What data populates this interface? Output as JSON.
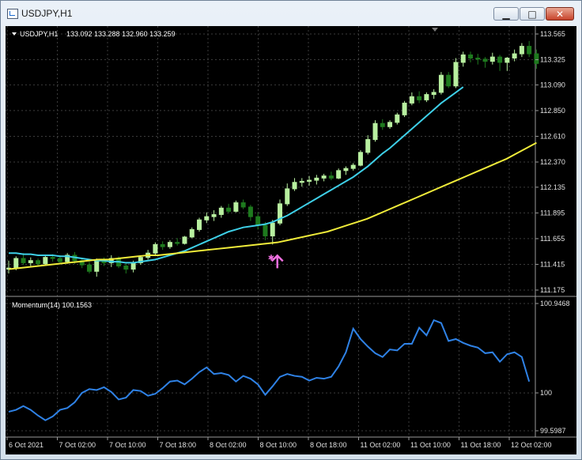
{
  "window": {
    "title": "USDJPY,H1",
    "buttons": {
      "minimize": "▁",
      "maximize": "□",
      "close": "✕"
    }
  },
  "colors": {
    "background": "#000000",
    "grid": "#3c3c3c",
    "axis_text": "#e0e0e0",
    "bull_candle": "#b8f0a0",
    "bear_candle": "#1e7a1e",
    "ma_fast": "#3ed0e8",
    "ma_slow": "#f0ec3a",
    "momentum": "#2f82e6",
    "signal_arrow": "#f070e0"
  },
  "chart_data": [
    {
      "type": "candlestick",
      "symbol_label": "USDJPY,H1",
      "ohlc_label": "133.092 133.288 132.960 133.259",
      "y_ticks": [
        "113.565",
        "113.325",
        "113.090",
        "112.850",
        "112.610",
        "112.370",
        "112.135",
        "111.895",
        "111.655",
        "111.415",
        "111.175"
      ],
      "ylim": [
        111.175,
        113.565
      ],
      "x_ticks": [
        "6 Oct 2021",
        "7 Oct 02:00",
        "7 Oct 10:00",
        "7 Oct 18:00",
        "8 Oct 02:00",
        "8 Oct 10:00",
        "8 Oct 18:00",
        "11 Oct 02:00",
        "11 Oct 10:00",
        "11 Oct 18:00",
        "12 Oct 02:00"
      ],
      "candles": [
        [
          111.37,
          111.45,
          111.33,
          111.38
        ],
        [
          111.38,
          111.49,
          111.36,
          111.47
        ],
        [
          111.47,
          111.52,
          111.41,
          111.43
        ],
        [
          111.43,
          111.48,
          111.4,
          111.45
        ],
        [
          111.45,
          111.47,
          111.4,
          111.42
        ],
        [
          111.42,
          111.5,
          111.41,
          111.48
        ],
        [
          111.48,
          111.51,
          111.44,
          111.47
        ],
        [
          111.47,
          111.5,
          111.43,
          111.44
        ],
        [
          111.44,
          111.52,
          111.42,
          111.5
        ],
        [
          111.5,
          111.53,
          111.42,
          111.45
        ],
        [
          111.45,
          111.47,
          111.38,
          111.41
        ],
        [
          111.41,
          111.44,
          111.33,
          111.35
        ],
        [
          111.35,
          111.47,
          111.3,
          111.45
        ],
        [
          111.45,
          111.48,
          111.4,
          111.43
        ],
        [
          111.43,
          111.5,
          111.39,
          111.47
        ],
        [
          111.47,
          111.49,
          111.38,
          111.4
        ],
        [
          111.4,
          111.43,
          111.33,
          111.37
        ],
        [
          111.37,
          111.45,
          111.34,
          111.43
        ],
        [
          111.43,
          111.5,
          111.41,
          111.48
        ],
        [
          111.48,
          111.55,
          111.46,
          111.52
        ],
        [
          111.52,
          111.62,
          111.5,
          111.6
        ],
        [
          111.6,
          111.63,
          111.55,
          111.58
        ],
        [
          111.58,
          111.64,
          111.56,
          111.62
        ],
        [
          111.62,
          111.66,
          111.59,
          111.61
        ],
        [
          111.61,
          111.68,
          111.6,
          111.67
        ],
        [
          111.67,
          111.76,
          111.66,
          111.74
        ],
        [
          111.74,
          111.85,
          111.72,
          111.83
        ],
        [
          111.83,
          111.9,
          111.8,
          111.86
        ],
        [
          111.86,
          111.92,
          111.82,
          111.88
        ],
        [
          111.88,
          111.96,
          111.85,
          111.94
        ],
        [
          111.94,
          111.98,
          111.89,
          111.91
        ],
        [
          111.91,
          112.01,
          111.9,
          111.99
        ],
        [
          111.99,
          112.02,
          111.93,
          111.95
        ],
        [
          111.95,
          111.97,
          111.82,
          111.86
        ],
        [
          111.86,
          111.9,
          111.74,
          111.78
        ],
        [
          111.78,
          111.81,
          111.64,
          111.68
        ],
        [
          111.68,
          111.83,
          111.6,
          111.8
        ],
        [
          111.8,
          112.02,
          111.78,
          111.98
        ],
        [
          111.98,
          112.17,
          111.96,
          112.12
        ],
        [
          112.12,
          112.22,
          112.1,
          112.18
        ],
        [
          112.18,
          112.22,
          112.14,
          112.19
        ],
        [
          112.19,
          112.24,
          112.15,
          112.2
        ],
        [
          112.2,
          112.25,
          112.16,
          112.22
        ],
        [
          112.22,
          112.26,
          112.19,
          112.24
        ],
        [
          112.24,
          112.28,
          112.2,
          112.22
        ],
        [
          112.22,
          112.31,
          112.21,
          112.29
        ],
        [
          112.29,
          112.33,
          112.25,
          112.31
        ],
        [
          112.31,
          112.36,
          112.29,
          112.34
        ],
        [
          112.34,
          112.48,
          112.33,
          112.46
        ],
        [
          112.46,
          112.62,
          112.44,
          112.58
        ],
        [
          112.58,
          112.76,
          112.56,
          112.73
        ],
        [
          112.73,
          112.77,
          112.67,
          112.7
        ],
        [
          112.7,
          112.76,
          112.68,
          112.74
        ],
        [
          112.74,
          112.83,
          112.72,
          112.81
        ],
        [
          112.81,
          112.94,
          112.79,
          112.92
        ],
        [
          112.92,
          113.02,
          112.9,
          112.98
        ],
        [
          112.98,
          113.03,
          112.92,
          112.95
        ],
        [
          112.95,
          113.02,
          112.93,
          113.0
        ],
        [
          113.0,
          113.05,
          112.96,
          113.02
        ],
        [
          113.02,
          113.21,
          113.0,
          113.18
        ],
        [
          113.18,
          113.21,
          113.06,
          113.08
        ],
        [
          113.08,
          113.34,
          113.06,
          113.3
        ],
        [
          113.3,
          113.4,
          113.26,
          113.37
        ],
        [
          113.37,
          113.4,
          113.3,
          113.34
        ],
        [
          113.34,
          113.38,
          113.28,
          113.33
        ],
        [
          113.33,
          113.35,
          113.25,
          113.31
        ],
        [
          113.31,
          113.39,
          113.28,
          113.35
        ],
        [
          113.35,
          113.37,
          113.22,
          113.3
        ],
        [
          113.3,
          113.35,
          113.22,
          113.34
        ],
        [
          113.34,
          113.42,
          113.31,
          113.38
        ],
        [
          113.38,
          113.48,
          113.35,
          113.45
        ],
        [
          113.45,
          113.5,
          113.35,
          113.38
        ],
        [
          113.38,
          113.42,
          113.24,
          113.29
        ]
      ],
      "ma_fast": [
        111.52,
        111.52,
        111.51,
        111.51,
        111.5,
        111.5,
        111.5,
        111.49,
        111.49,
        111.48,
        111.47,
        111.46,
        111.45,
        111.45,
        111.44,
        111.44,
        111.43,
        111.43,
        111.44,
        111.45,
        111.46,
        111.48,
        111.5,
        111.52,
        111.54,
        111.57,
        111.6,
        111.63,
        111.66,
        111.69,
        111.72,
        111.74,
        111.76,
        111.77,
        111.78,
        111.79,
        111.81,
        111.84,
        111.87,
        111.91,
        111.95,
        111.99,
        112.03,
        112.07,
        112.11,
        112.15,
        112.19,
        112.23,
        112.28,
        112.33,
        112.39,
        112.45,
        112.5,
        112.56,
        112.62,
        112.68,
        112.74,
        112.8,
        112.86,
        112.92,
        112.97,
        113.02,
        113.07
      ],
      "ma_slow": [
        111.37,
        111.38,
        111.39,
        111.4,
        111.41,
        111.42,
        111.43,
        111.44,
        111.45,
        111.46,
        111.46,
        111.47,
        111.48,
        111.49,
        111.5,
        111.5,
        111.51,
        111.52,
        111.53,
        111.54,
        111.55,
        111.56,
        111.57,
        111.58,
        111.59,
        111.6,
        111.61,
        111.62,
        111.64,
        111.66,
        111.68,
        111.7,
        111.72,
        111.75,
        111.78,
        111.81,
        111.84,
        111.88,
        111.92,
        111.96,
        112.0,
        112.04,
        112.08,
        112.12,
        112.16,
        112.2,
        112.24,
        112.28,
        112.32,
        112.36,
        112.4,
        112.45,
        112.5,
        112.55
      ],
      "signal": {
        "candle_index": 36,
        "direction": "up"
      }
    },
    {
      "type": "line",
      "indicator_label": "Momentum(14) 100.1563",
      "y_ticks": [
        "100.9468",
        "100",
        "99.5987"
      ],
      "ylim": [
        99.5987,
        100.9468
      ],
      "values": [
        99.8,
        99.82,
        99.86,
        99.82,
        99.76,
        99.71,
        99.75,
        99.82,
        99.84,
        99.9,
        100.0,
        100.04,
        100.03,
        100.06,
        100.01,
        99.93,
        99.95,
        100.03,
        100.02,
        99.97,
        99.99,
        100.05,
        100.12,
        100.13,
        100.09,
        100.15,
        100.22,
        100.27,
        100.2,
        100.21,
        100.19,
        100.12,
        100.18,
        100.15,
        100.09,
        99.98,
        100.07,
        100.17,
        100.2,
        100.18,
        100.17,
        100.13,
        100.16,
        100.15,
        100.17,
        100.28,
        100.43,
        100.68,
        100.57,
        100.49,
        100.42,
        100.38,
        100.46,
        100.45,
        100.52,
        100.52,
        100.69,
        100.61,
        100.77,
        100.74,
        100.55,
        100.57,
        100.53,
        100.5,
        100.48,
        100.42,
        100.43,
        100.33,
        100.41,
        100.43,
        100.38,
        100.12
      ]
    }
  ]
}
